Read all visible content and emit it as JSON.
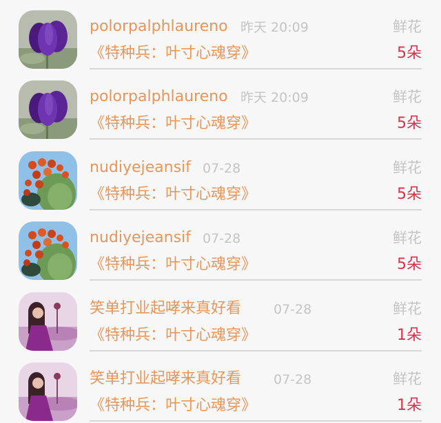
{
  "records": [
    {
      "user": "polorpalphlaureno",
      "time": "昨天 20:09",
      "gift_type": "鲜花",
      "title": "《特种兵：叶寸心魂穿》",
      "count": "5朵",
      "avatar": "purple-tulip-avatar"
    },
    {
      "user": "polorpalphlaureno",
      "time": "昨天 20:09",
      "gift_type": "鲜花",
      "title": "《特种兵：叶寸心魂穿》",
      "count": "5朵",
      "avatar": "purple-tulip-avatar"
    },
    {
      "user": "nudiyejeansif",
      "time": "07-28",
      "gift_type": "鲜花",
      "title": "《特种兵：叶寸心魂穿》",
      "count": "5朵",
      "avatar": "cactus-avatar"
    },
    {
      "user": "nudiyejeansif",
      "time": "07-28",
      "gift_type": "鲜花",
      "title": "《特种兵：叶寸心魂穿》",
      "count": "5朵",
      "avatar": "cactus-avatar"
    },
    {
      "user": "笑单打业起哮来真好看",
      "time": "07-28",
      "gift_type": "鲜花",
      "title": "《特种兵：叶寸心魂穿》",
      "count": "1朵",
      "avatar": "girl-in-field-avatar"
    },
    {
      "user": "笑单打业起哮来真好看",
      "time": "07-28",
      "gift_type": "鲜花",
      "title": "《特种兵：叶寸心魂穿》",
      "count": "1朵",
      "avatar": "girl-in-field-avatar"
    }
  ],
  "colors": {
    "accent": "#e8955a",
    "count": "#d9304a",
    "muted": "#c4c4c4",
    "divider": "#d6d6d6"
  }
}
